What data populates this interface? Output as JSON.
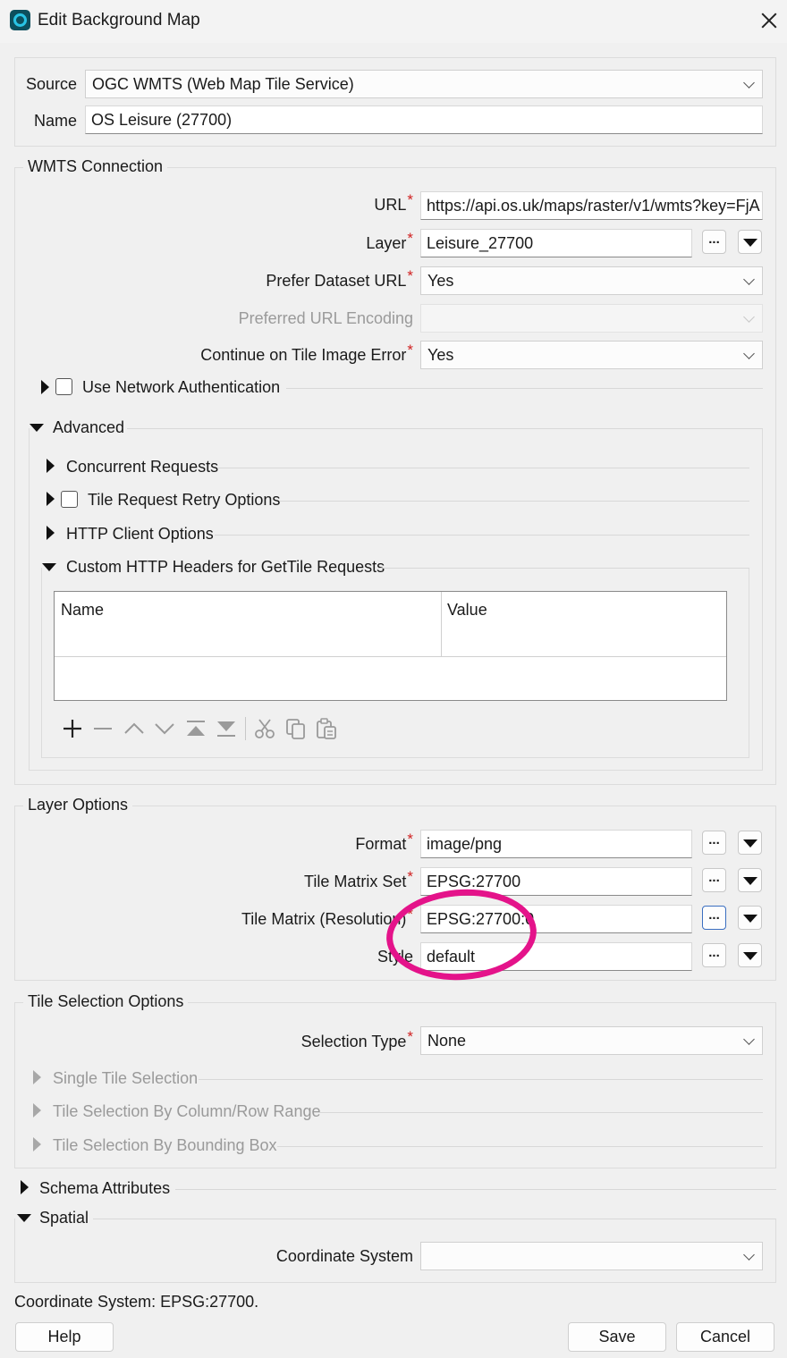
{
  "window": {
    "title": "Edit Background Map"
  },
  "source": {
    "label": "Source",
    "value": "OGC WMTS (Web Map Tile Service)"
  },
  "name": {
    "label": "Name",
    "value": "OS Leisure (27700)"
  },
  "wmts": {
    "title": "WMTS Connection",
    "url_label": "URL",
    "url_value": "https://api.os.uk/maps/raster/v1/wmts?key=FjA",
    "layer_label": "Layer",
    "layer_value": "Leisure_27700",
    "prefer_label": "Prefer Dataset URL",
    "prefer_value": "Yes",
    "encoding_label": "Preferred URL Encoding",
    "encoding_value": "",
    "continue_label": "Continue on Tile Image Error",
    "continue_value": "Yes",
    "auth_label": "Use Network Authentication"
  },
  "advanced": {
    "title": "Advanced",
    "concurrent": "Concurrent Requests",
    "retry": "Tile Request Retry Options",
    "http_client": "HTTP Client Options",
    "headers": "Custom HTTP Headers for GetTile Requests",
    "col_name": "Name",
    "col_value": "Value"
  },
  "buttons": {
    "dots": "..."
  },
  "layer_options": {
    "title": "Layer Options",
    "format_label": "Format",
    "format_value": "image/png",
    "tms_label": "Tile Matrix Set",
    "tms_value": "EPSG:27700",
    "tm_label": "Tile Matrix (Resolution)",
    "tm_value": "EPSG:27700:0",
    "style_label": "Style",
    "style_value": "default"
  },
  "tile_selection": {
    "title": "Tile Selection Options",
    "type_label": "Selection Type",
    "type_value": "None",
    "single": "Single Tile Selection",
    "colrow": "Tile Selection By Column/Row Range",
    "bbox": "Tile Selection By Bounding Box"
  },
  "schema": {
    "title": "Schema Attributes"
  },
  "spatial": {
    "title": "Spatial",
    "cs_label": "Coordinate System",
    "cs_value": ""
  },
  "status": {
    "text": "Coordinate System: EPSG:27700."
  },
  "footer": {
    "help": "Help",
    "save": "Save",
    "cancel": "Cancel"
  },
  "colors": {
    "annotation": "#e4138a",
    "required": "#d02020",
    "focus": "#3a6ec0"
  }
}
